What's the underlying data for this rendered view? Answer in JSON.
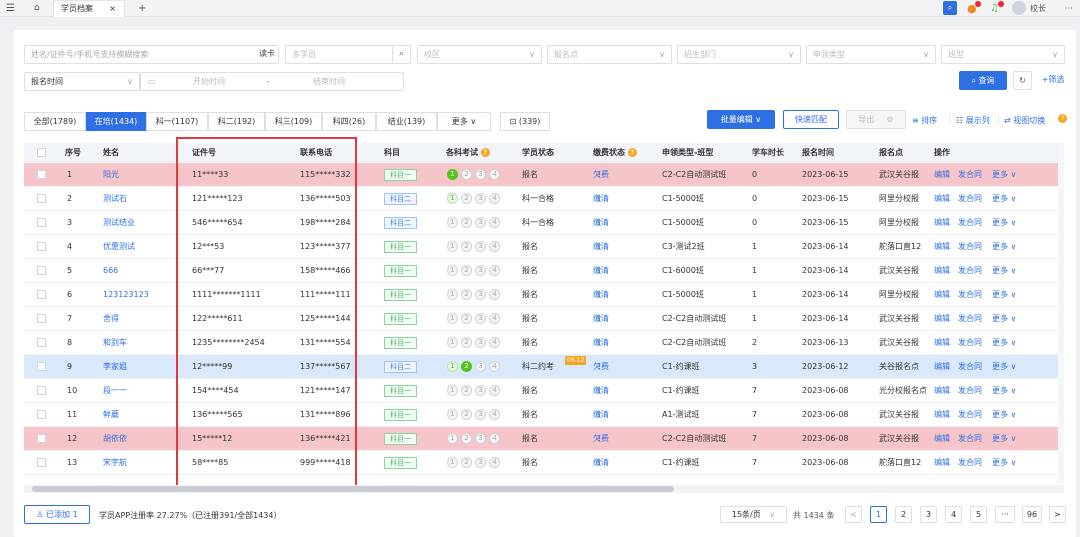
{
  "topbar": {
    "menu_icon": "menu-icon",
    "home_icon": "home-icon",
    "tab_label": "学员档案",
    "tab_close": "×",
    "add_tab": "+",
    "user": "校长",
    "more": "···"
  },
  "filters": {
    "search_placeholder": "姓名/证件号/手机号支持模糊搜索",
    "read_card": "读卡",
    "multi_student": "多学员",
    "campus": "校区",
    "signup_point": "报名点",
    "recruit_dept": "招生部门",
    "apply_type": "申领类型",
    "class_type": "班型",
    "signup_time": "报名时间",
    "start_time": "开始时间",
    "dash": "-",
    "end_time": "结束时间",
    "query": "查询",
    "filter": "+筛选"
  },
  "tabs": [
    {
      "label": "全部(1789)"
    },
    {
      "label": "在培(1434)"
    },
    {
      "label": "科一(1107)"
    },
    {
      "label": "科二(192)"
    },
    {
      "label": "科三(109)"
    },
    {
      "label": "科四(26)"
    },
    {
      "label": "结业(139)"
    },
    {
      "label": "更多 ∨"
    }
  ],
  "trash_count": "(339)",
  "toolbar": {
    "batch_edit": "批量编辑 ∨",
    "quick_match": "快速匹配",
    "export": "导出",
    "sort": "排序",
    "columns": "展示列",
    "switch_view": "视图切换"
  },
  "columns": [
    "序号",
    "姓名",
    "证件号",
    "联系电话",
    "科目",
    "各科考试",
    "学员状态",
    "缴费状态",
    "申领类型-班型",
    "学车时长",
    "报名时间",
    "报名点",
    "操作"
  ],
  "rows": [
    {
      "no": "1",
      "name": "阳光",
      "id": "11****33",
      "phone": "115*****332",
      "subject": "科目一",
      "exam": [
        1,
        0,
        0,
        0
      ],
      "status": "报名",
      "pay": "欠费",
      "class": "C2-C2自动测试班",
      "hours": "0",
      "date": "2023-06-15",
      "point": "武汉关谷报",
      "style": "red"
    },
    {
      "no": "2",
      "name": "测试石",
      "id": "121*****123",
      "phone": "136*****503",
      "subject": "科目二",
      "exam": [
        2,
        0,
        0,
        0
      ],
      "status": "科一合格",
      "pay": "缴清",
      "class": "C1-5000班",
      "hours": "0",
      "date": "2023-06-15",
      "point": "阿里分校报",
      "style": ""
    },
    {
      "no": "3",
      "name": "测试结业",
      "id": "546*****654",
      "phone": "198*****284",
      "subject": "科目二",
      "exam": [
        0,
        0,
        0,
        0
      ],
      "status": "科一合格",
      "pay": "缴清",
      "class": "C1-5000班",
      "hours": "0",
      "date": "2023-06-15",
      "point": "阿里分校报",
      "style": ""
    },
    {
      "no": "4",
      "name": "优惠测试",
      "id": "12***53",
      "phone": "123*****377",
      "subject": "科目一",
      "exam": [
        0,
        0,
        0,
        0
      ],
      "status": "报名",
      "pay": "缴清",
      "class": "C3-测试2班",
      "hours": "1",
      "date": "2023-06-14",
      "point": "舵落口直12",
      "style": ""
    },
    {
      "no": "5",
      "name": "666",
      "id": "66***77",
      "phone": "158*****466",
      "subject": "科目一",
      "exam": [
        0,
        0,
        0,
        0
      ],
      "status": "报名",
      "pay": "缴清",
      "class": "C1-6000班",
      "hours": "1",
      "date": "2023-06-14",
      "point": "武汉关谷报",
      "style": ""
    },
    {
      "no": "6",
      "name": "123123123",
      "id": "1111*******1111",
      "phone": "111*****111",
      "subject": "科目一",
      "exam": [
        0,
        0,
        0,
        0
      ],
      "status": "报名",
      "pay": "缴清",
      "class": "C1-5000班",
      "hours": "1",
      "date": "2023-06-14",
      "point": "阿里分校报",
      "style": ""
    },
    {
      "no": "7",
      "name": "舍得",
      "id": "122*****611",
      "phone": "125*****144",
      "subject": "科目一",
      "exam": [
        0,
        0,
        0,
        0
      ],
      "status": "报名",
      "pay": "缴清",
      "class": "C2-C2自动测试班",
      "hours": "1",
      "date": "2023-06-14",
      "point": "武汉关谷报",
      "style": ""
    },
    {
      "no": "8",
      "name": "和别车",
      "id": "1235********2454",
      "phone": "131*****554",
      "subject": "科目一",
      "exam": [
        0,
        0,
        0,
        0
      ],
      "status": "报名",
      "pay": "缴清",
      "class": "C2-C2自动测试班",
      "hours": "2",
      "date": "2023-06-13",
      "point": "武汉关谷报",
      "style": ""
    },
    {
      "no": "9",
      "name": "李家姐",
      "id": "12*****99",
      "phone": "137*****567",
      "subject": "科目二",
      "exam": [
        2,
        1,
        0,
        0
      ],
      "status": "科二约考",
      "pay": "欠费",
      "class": "C1-约课班",
      "hours": "3",
      "date": "2023-06-12",
      "point": "关谷报名点",
      "style": "bluerow",
      "badge": "06-12"
    },
    {
      "no": "10",
      "name": "段一一",
      "id": "154****454",
      "phone": "121*****147",
      "subject": "科目一",
      "exam": [
        0,
        0,
        0,
        0
      ],
      "status": "报名",
      "pay": "缴清",
      "class": "C1-约课班",
      "hours": "7",
      "date": "2023-06-08",
      "point": "光分校报名点",
      "style": ""
    },
    {
      "no": "11",
      "name": "鲜蘑",
      "id": "136*****565",
      "phone": "131*****896",
      "subject": "科目一",
      "exam": [
        0,
        0,
        0,
        0
      ],
      "status": "报名",
      "pay": "缴清",
      "class": "A1-测试班",
      "hours": "7",
      "date": "2023-06-08",
      "point": "武汉关谷报",
      "style": ""
    },
    {
      "no": "12",
      "name": "胡依依",
      "id": "15*****12",
      "phone": "136*****421",
      "subject": "科目一",
      "exam": [
        0,
        0,
        0,
        0
      ],
      "status": "报名",
      "pay": "欠费",
      "class": "C2-C2自动测试班",
      "hours": "7",
      "date": "2023-06-08",
      "point": "武汉关谷报",
      "style": "red"
    },
    {
      "no": "13",
      "name": "宋宇航",
      "id": "58****85",
      "phone": "999*****418",
      "subject": "科目一",
      "exam": [
        0,
        0,
        0,
        0
      ],
      "status": "报名",
      "pay": "缴清",
      "class": "C1-约课班",
      "hours": "7",
      "date": "2023-06-08",
      "point": "舵落口直12",
      "style": ""
    }
  ],
  "row_actions": {
    "edit": "编辑",
    "contract": "发合同",
    "more": "更多 ∨"
  },
  "footer": {
    "added": "已添加 1",
    "app_rate": "学员APP注册率 27.27%（已注册391/全部1434）",
    "page_size": "15条/页",
    "total": "共 1434 条",
    "pages": [
      "1",
      "2",
      "3",
      "4",
      "5",
      "···",
      "96"
    ],
    "prev": "<",
    "next": ">"
  },
  "colors": {
    "primary": "#2f6fe4",
    "red_row": "#f6c5c9",
    "blue_row": "#d9e8fb",
    "highlight_box": "#e23a3a"
  }
}
